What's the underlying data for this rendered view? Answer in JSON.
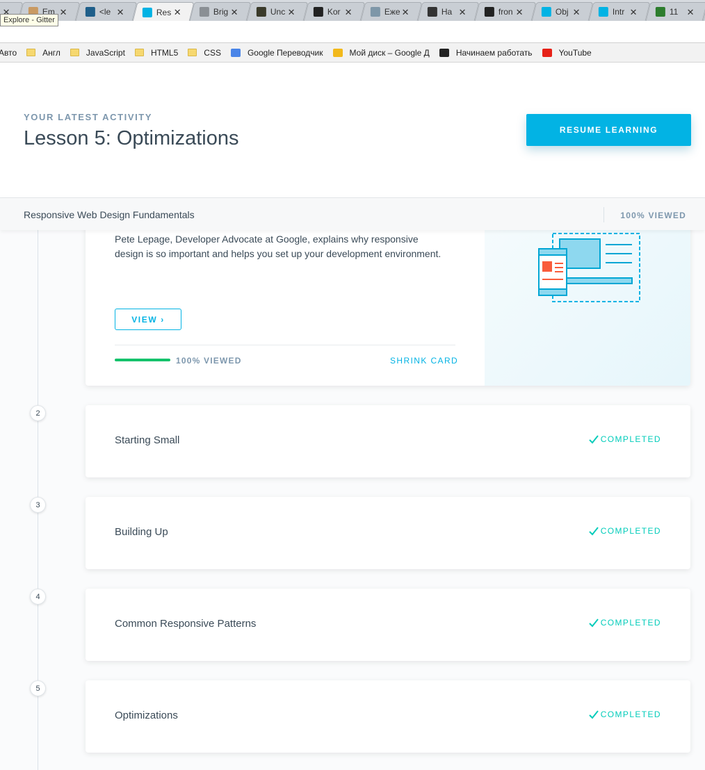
{
  "browser": {
    "tooltip": "Explore - Gitter",
    "tabs": [
      {
        "label": "",
        "color": "#9aa1a8"
      },
      {
        "label": "Em",
        "color": "#c99a62"
      },
      {
        "label": "<le",
        "color": "#1f5f8a"
      },
      {
        "label": "Res",
        "color": "#02b3e4",
        "active": true
      },
      {
        "label": "Brig",
        "color": "#8a8f94"
      },
      {
        "label": "Unc",
        "color": "#3a3a2a"
      },
      {
        "label": "Kor",
        "color": "#222222"
      },
      {
        "label": "Еже",
        "color": "#7e97a8"
      },
      {
        "label": "На",
        "color": "#333333"
      },
      {
        "label": "fron",
        "color": "#222222"
      },
      {
        "label": "Obj",
        "color": "#02b3e4"
      },
      {
        "label": "Intr",
        "color": "#02b3e4"
      },
      {
        "label": "11",
        "color": "#2d7d2d"
      },
      {
        "label": "",
        "color": "#2e4d3a"
      }
    ],
    "bookmarks": [
      {
        "label": "Авто",
        "icon": "none"
      },
      {
        "label": "Англ",
        "icon": "folder-icon"
      },
      {
        "label": "JavaScript",
        "icon": "folder-icon"
      },
      {
        "label": "HTML5",
        "icon": "folder-icon"
      },
      {
        "label": "CSS",
        "icon": "folder-icon"
      },
      {
        "label": "Google Переводчик",
        "icon": "translate-icon"
      },
      {
        "label": "Мой диск – Google Д",
        "icon": "drive-icon"
      },
      {
        "label": "Начинаем работать",
        "icon": "ht-icon"
      },
      {
        "label": "YouTube",
        "icon": "youtube-icon"
      }
    ]
  },
  "activity": {
    "kicker": "YOUR LATEST ACTIVITY",
    "title": "Lesson 5: Optimizations",
    "resume_label": "RESUME LEARNING"
  },
  "course": {
    "name": "Responsive Web Design Fundamentals",
    "viewed": "100% VIEWED"
  },
  "expanded_card": {
    "description": "Pete Lepage, Developer Advocate at Google, explains why responsive design is so important and helps you set up your development environment.",
    "view_label": "VIEW ›",
    "progress": 1.0,
    "viewed_label": "100% VIEWED",
    "shrink_label": "SHRINK CARD"
  },
  "lessons": [
    {
      "number": "2",
      "title": "Starting Small",
      "status": "COMPLETED"
    },
    {
      "number": "3",
      "title": "Building Up",
      "status": "COMPLETED"
    },
    {
      "number": "4",
      "title": "Common Responsive Patterns",
      "status": "COMPLETED"
    },
    {
      "number": "5",
      "title": "Optimizations",
      "status": "COMPLETED"
    }
  ],
  "colors": {
    "accent": "#02b3e4",
    "completed": "#02ccba",
    "progress": "#15c26b"
  }
}
